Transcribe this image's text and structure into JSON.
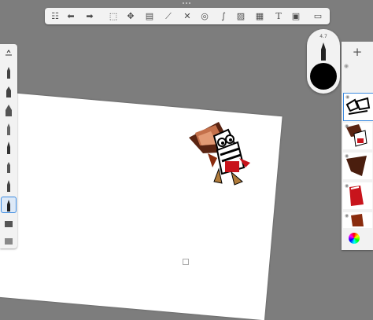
{
  "toolbar": {
    "icons": [
      "gallery-icon",
      "undo-icon",
      "redo-icon",
      "select-icon",
      "transform-icon",
      "layers-stack-icon",
      "ruler-icon",
      "symmetry-icon",
      "shapes-icon",
      "curve-icon",
      "image-icon",
      "perspective-icon",
      "text-icon",
      "video-icon",
      "fullscreen-icon"
    ]
  },
  "brush_puck": {
    "size_value": "4.7"
  },
  "layers": {
    "add_label": "+",
    "count": 5
  },
  "colors": {
    "accent": "#3d8be0",
    "paper": "#ffffff",
    "background": "#7d7d7d"
  }
}
